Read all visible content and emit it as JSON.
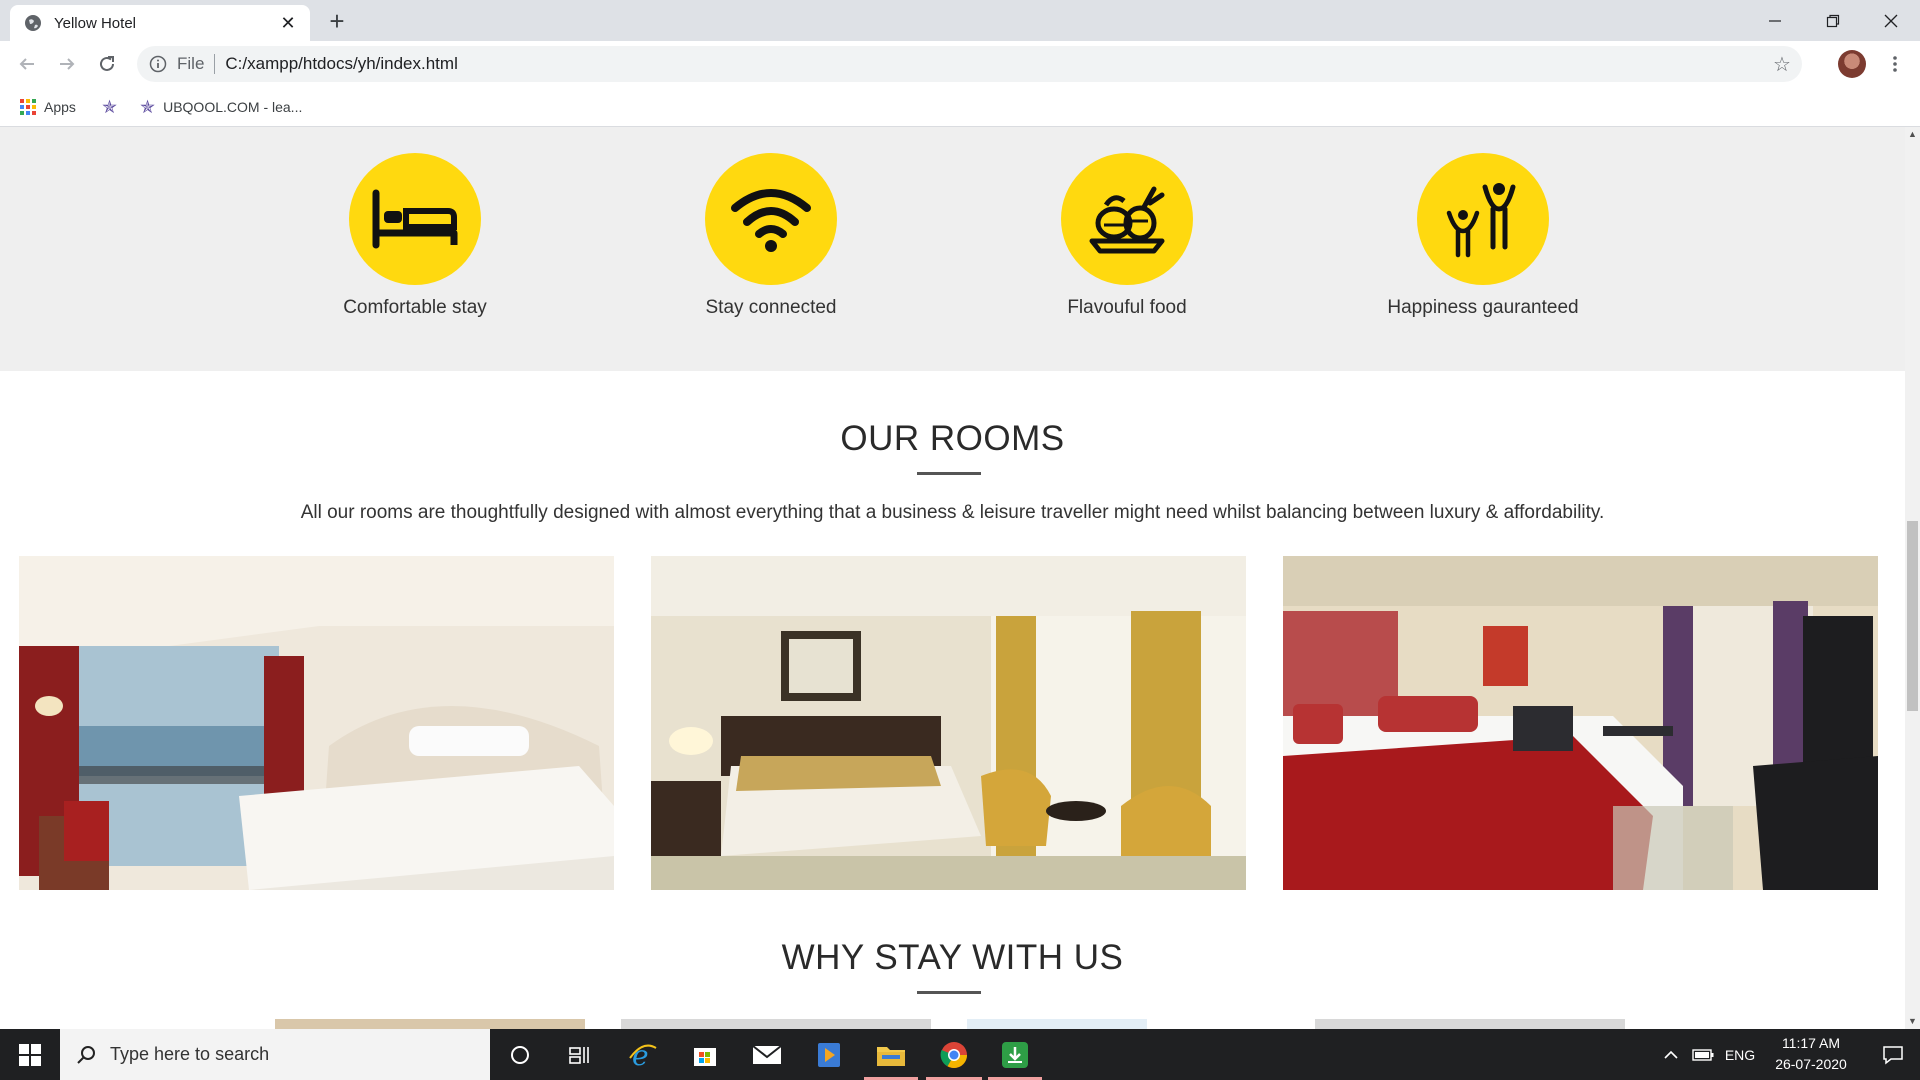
{
  "browser": {
    "tab_title": "Yellow Hotel",
    "new_tab": "+",
    "close_tab": "✕",
    "url_protocol": "File",
    "url": "C:/xampp/htdocs/yh/index.html",
    "bookmarks": [
      {
        "label": "Apps",
        "icon": "apps-grid-icon"
      },
      {
        "label": "",
        "icon": "bookmark-star-icon"
      },
      {
        "label": "UBQOOL.COM - lea...",
        "icon": "bookmark-star-icon"
      }
    ]
  },
  "features": [
    {
      "label": "Comfortable stay",
      "icon": "bed-icon"
    },
    {
      "label": "Stay connected",
      "icon": "wifi-icon"
    },
    {
      "label": "Flavouful food",
      "icon": "food-basket-icon"
    },
    {
      "label": "Happiness gauranteed",
      "icon": "people-celebrate-icon"
    }
  ],
  "rooms": {
    "title": "OUR ROOMS",
    "description": "All our rooms are thoughtfully designed with almost everything that a business & leisure traveller might need whilst balancing between luxury & affordability."
  },
  "why": {
    "title": "WHY STAY WITH US"
  },
  "taskbar": {
    "search_placeholder": "Type here to search",
    "language": "ENG",
    "time": "11:17 AM",
    "date": "26-07-2020"
  },
  "colors": {
    "accent_yellow": "#ffd90f",
    "feature_band": "#efefef",
    "taskbar": "#1f2022"
  }
}
